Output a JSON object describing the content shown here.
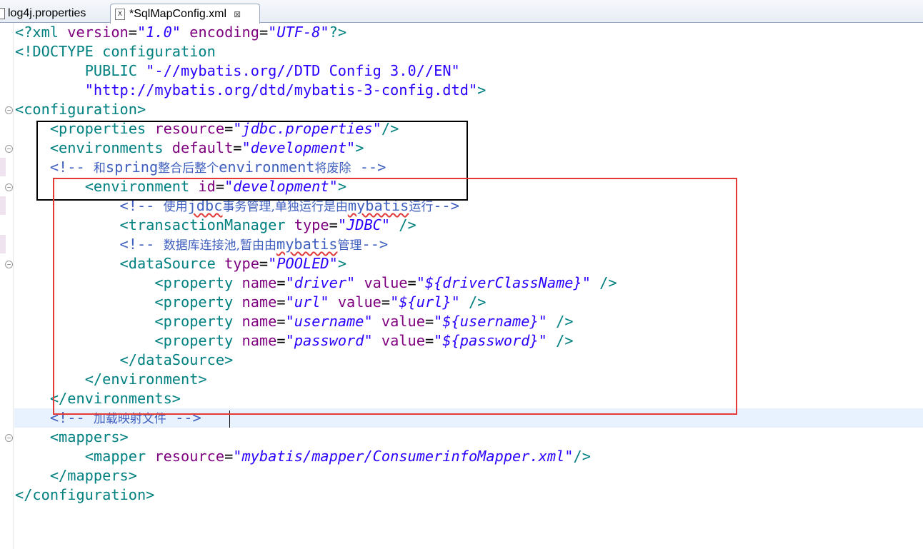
{
  "tabs": [
    {
      "label": "log4j.properties",
      "active": false
    },
    {
      "label": "*SqlMapConfig.xml",
      "active": true
    }
  ],
  "icons": {
    "xml": "X",
    "close": "⊠"
  },
  "code": {
    "l1": {
      "a": "<?",
      "b": "xml",
      "c": " version",
      "d": "=",
      "e": "\"1.0\"",
      "f": " encoding",
      "g": "=",
      "h": "\"UTF-8\"",
      "i": "?>"
    },
    "l2": {
      "a": "<!DOCTYPE",
      "b": " configuration"
    },
    "l3": {
      "indent": "        ",
      "a": "PUBLIC",
      "b": " \"-//mybatis.org//DTD Config 3.0//EN\""
    },
    "l4": {
      "indent": "        ",
      "a": "\"http://mybatis.org/dtd/mybatis-3-config.dtd\"",
      "b": ">"
    },
    "l5": {
      "a": "<configuration>"
    },
    "l6": {
      "indent": "    ",
      "a": "<properties",
      "b": " resource",
      "c": "=",
      "d": "\"jdbc.properties\"",
      "e": "/>"
    },
    "l7": {
      "indent": "    ",
      "a": "<environments",
      "b": " default",
      "c": "=",
      "d": "\"development\"",
      "e": ">"
    },
    "l8": {
      "indent": "    ",
      "a": "<!-- ",
      "b": "和",
      "c": "spring",
      "d": "整合后整个",
      "e": "environment",
      "f": "将废除",
      "g": " -->"
    },
    "l9": {
      "indent": "        ",
      "a": "<environment",
      "b": " id",
      "c": "=",
      "d": "\"development\"",
      "e": ">"
    },
    "l10": {
      "indent": "            ",
      "a": "<!-- ",
      "b": "使用",
      "c": "jdbc",
      "d": "事务管理,单独运行是由",
      "e": "mybatis",
      "f": "运行",
      "g": "-->"
    },
    "l11": {
      "indent": "            ",
      "a": "<transactionManager",
      "b": " type",
      "c": "=",
      "d": "\"JDBC\"",
      "e": " />"
    },
    "l12": {
      "indent": "            ",
      "a": "<!-- ",
      "b": "数据库连接池,暂由由",
      "c": "mybatis",
      "d": "管理",
      "e": "-->"
    },
    "l13": {
      "indent": "            ",
      "a": "<dataSource",
      "b": " type",
      "c": "=",
      "d": "\"POOLED\"",
      "e": ">"
    },
    "l14": {
      "indent": "                ",
      "a": "<property",
      "b": " name",
      "c": "=",
      "d": "\"driver\"",
      "e": " value",
      "f": "=",
      "g": "\"${driverClassName}\"",
      "h": " />"
    },
    "l15": {
      "indent": "                ",
      "a": "<property",
      "b": " name",
      "c": "=",
      "d": "\"url\"",
      "e": " value",
      "f": "=",
      "g": "\"${url}\"",
      "h": " />"
    },
    "l16": {
      "indent": "                ",
      "a": "<property",
      "b": " name",
      "c": "=",
      "d": "\"username\"",
      "e": " value",
      "f": "=",
      "g": "\"${username}\"",
      "h": " />"
    },
    "l17": {
      "indent": "                ",
      "a": "<property",
      "b": " name",
      "c": "=",
      "d": "\"password\"",
      "e": " value",
      "f": "=",
      "g": "\"${password}\"",
      "h": " />"
    },
    "l18": {
      "indent": "            ",
      "a": "</dataSource>"
    },
    "l19": {
      "indent": "        ",
      "a": "</environment>"
    },
    "l20": {
      "indent": "    ",
      "a": "</environments>"
    },
    "l21": {
      "indent": "    ",
      "a": "<!-- ",
      "b": "加载映射文件",
      "c": " -->"
    },
    "l22": {
      "indent": "    ",
      "a": "<mappers>"
    },
    "l23": {
      "indent": "        ",
      "a": "<mapper",
      "b": " resource",
      "c": "=",
      "d": "\"mybatis/mapper/ConsumerinfoMapper.xml\"",
      "e": "/>"
    },
    "l24": {
      "indent": "    ",
      "a": "</mappers>"
    },
    "l25": {
      "a": "</configuration>"
    }
  },
  "colors": {
    "tag": "#008080",
    "attribute": "#7f007f",
    "value": "#2a00ff",
    "comment": "#3f5fbf",
    "highlight_box_black": "#000000",
    "highlight_box_red": "#e53935"
  }
}
